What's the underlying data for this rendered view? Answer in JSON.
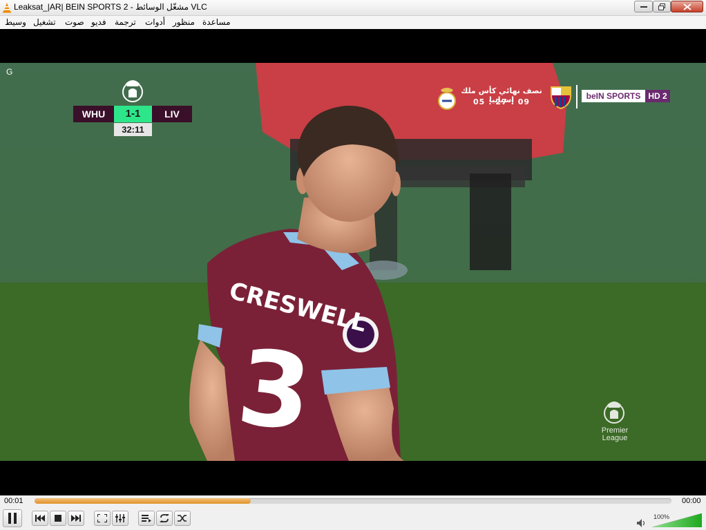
{
  "window": {
    "title": "Leaksat_|AR| BEIN SPORTS 2 - مشغّل الوسائط VLC"
  },
  "menu": {
    "items": [
      "وسيط",
      "تشغيل",
      "صوت",
      "فديو",
      "ترجمة",
      "أدوات",
      "منظور",
      "مساعدة"
    ]
  },
  "overlay": {
    "corner_mark": "G",
    "scoreboard": {
      "home": "WHU",
      "score": "1-1",
      "away": "LIV",
      "clock": "32:11"
    },
    "promo": {
      "text": "نصف نهائي كأس ملك إسبانيا",
      "time": "05 : 27 : 09"
    },
    "channel": {
      "name": "beIN SPORTS",
      "hd": "HD 2"
    },
    "league_watermark": "Premier League",
    "player_name": "CRESWELL",
    "player_number": "3"
  },
  "playback": {
    "elapsed": "00:01",
    "total": "00:00",
    "progress": 0.34,
    "volume_label": "100%",
    "volume": 1.0
  },
  "colors": {
    "seek_fill": "#e0922a",
    "score_green": "#2ee68a",
    "team_maroon": "#3a0f2a",
    "bein_purple": "#6a2a6e",
    "volume_green": "#2fbf2f"
  },
  "icons": {
    "app": "vlc-cone-icon",
    "pause": "pause-icon",
    "prev": "previous-icon",
    "stop": "stop-icon",
    "next": "next-icon",
    "fullscreen": "fullscreen-icon",
    "extended": "extended-settings-icon",
    "playlist": "playlist-icon",
    "loop": "loop-icon",
    "shuffle": "shuffle-icon",
    "volume": "speaker-icon"
  }
}
